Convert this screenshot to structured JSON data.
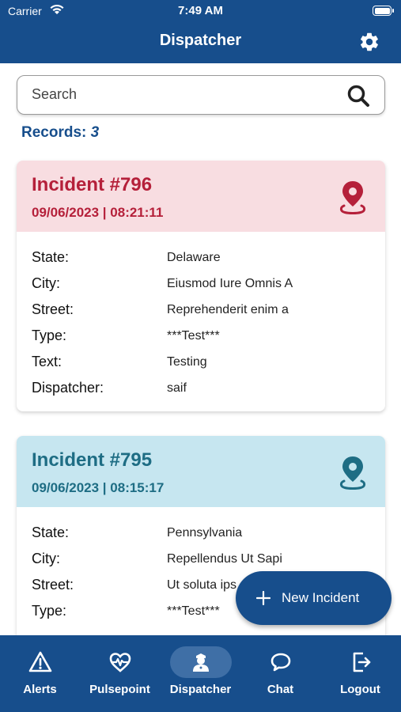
{
  "status_bar": {
    "carrier": "Carrier",
    "time": "7:49 AM"
  },
  "header": {
    "title": "Dispatcher",
    "settings_icon": "gear-icon"
  },
  "search": {
    "placeholder": "Search",
    "icon": "search-icon"
  },
  "records": {
    "label": "Records:",
    "count": "3"
  },
  "incidents": [
    {
      "title": "Incident #796",
      "datetime": "09/06/2023 | 08:21:11",
      "accent": "#b5203a",
      "background": "#f8dde1",
      "fields": [
        {
          "label": "State:",
          "value": "Delaware"
        },
        {
          "label": "City:",
          "value": "Eiusmod Iure Omnis A"
        },
        {
          "label": "Street:",
          "value": "Reprehenderit enim a"
        },
        {
          "label": "Type:",
          "value": "***Test***"
        },
        {
          "label": "Text:",
          "value": "Testing"
        },
        {
          "label": "Dispatcher:",
          "value": "saif"
        }
      ]
    },
    {
      "title": "Incident #795",
      "datetime": "09/06/2023 | 08:15:17",
      "accent": "#1e6d84",
      "background": "#c6e6f0",
      "fields": [
        {
          "label": "State:",
          "value": "Pennsylvania"
        },
        {
          "label": "City:",
          "value": "Repellendus Ut Sapi"
        },
        {
          "label": "Street:",
          "value": "Ut soluta ips"
        },
        {
          "label": "Type:",
          "value": "***Test***"
        }
      ]
    }
  ],
  "fab": {
    "label": "New Incident",
    "icon": "plus-icon"
  },
  "tabs": [
    {
      "label": "Alerts",
      "icon": "alert-triangle-icon"
    },
    {
      "label": "Pulsepoint",
      "icon": "heart-pulse-icon"
    },
    {
      "label": "Dispatcher",
      "icon": "dispatcher-user-icon",
      "active": true
    },
    {
      "label": "Chat",
      "icon": "chat-bubble-icon"
    },
    {
      "label": "Logout",
      "icon": "logout-icon"
    }
  ],
  "colors": {
    "primary": "#174e8c",
    "active_tab": "#3f6fa6"
  }
}
